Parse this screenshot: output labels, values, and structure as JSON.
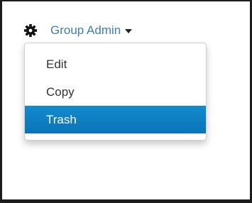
{
  "dropdown": {
    "icon": "gear-icon",
    "label": "Group Admin",
    "caret_icon": "caret-down-icon",
    "items": [
      {
        "label": "Edit",
        "active": false
      },
      {
        "label": "Copy",
        "active": false
      },
      {
        "label": "Trash",
        "active": true
      }
    ]
  },
  "colors": {
    "link": "#3f7eb3",
    "highlight": "#0e81c4",
    "text": "#333333"
  }
}
